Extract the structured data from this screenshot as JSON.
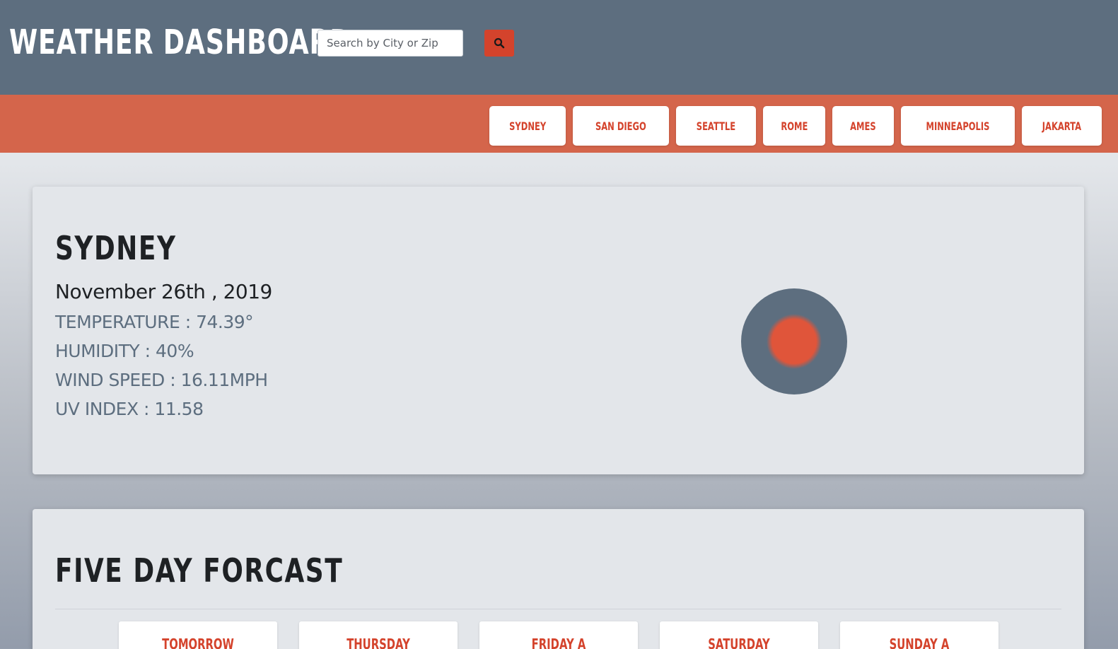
{
  "header": {
    "title": "WEATHER DASHBOARD",
    "search": {
      "placeholder": "Search by City or Zip",
      "value": ""
    },
    "search_button_icon": "search-icon"
  },
  "saved_cities": [
    "SYDNEY",
    "SAN DIEGO",
    "SEATTLE",
    "ROME",
    "AMES",
    "MINNEAPOLIS",
    "JAKARTA"
  ],
  "current": {
    "city": "SYDNEY",
    "date": "November 26th , 2019",
    "temperature": "TEMPERATURE : 74.39°",
    "humidity": "HUMIDITY : 40%",
    "wind_speed": "WIND SPEED : 16.11MPH",
    "uv_index": "UV  INDEX : 11.58",
    "weather_icon": "sun-icon"
  },
  "forecast": {
    "title": "FIVE DAY FORCAST",
    "days": [
      "TOMORROW",
      "THURSDAY",
      "FRIDAY A",
      "SATURDAY",
      "SUNDAY A"
    ]
  },
  "colors": {
    "header_bg": "#5d6e7f",
    "accent": "#d4432c",
    "nav_strip": "#d4654b",
    "card_bg": "#e3e6ea",
    "stat_text": "#5d6e7f"
  }
}
